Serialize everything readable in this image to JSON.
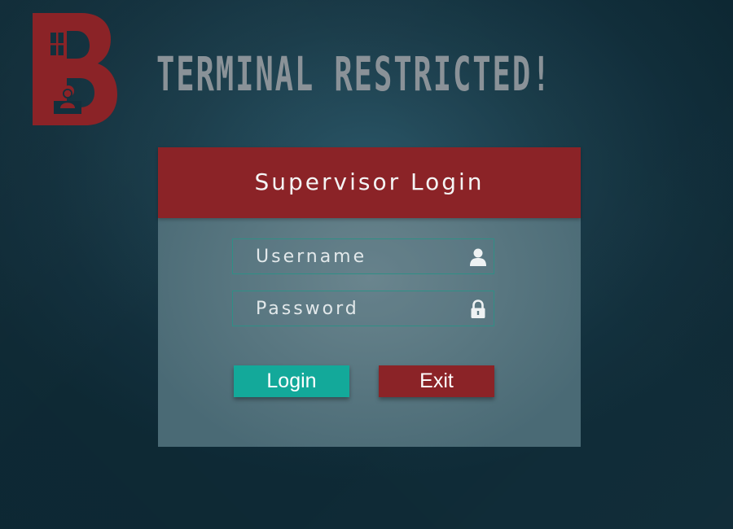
{
  "headline": "TERMINAL RESTRICTED!",
  "logo": {
    "letter": "B",
    "color": "#8b2327"
  },
  "login": {
    "title": "Supervisor Login",
    "username": {
      "placeholder": "Username",
      "value": "",
      "icon": "user-icon"
    },
    "password": {
      "placeholder": "Password",
      "value": "",
      "icon": "padlock-icon"
    },
    "buttons": {
      "login_label": "Login",
      "exit_label": "Exit"
    }
  },
  "colors": {
    "background": "#1b3d4b",
    "header_red": "#8b2327",
    "login_teal": "#13a99a",
    "exit_red": "#8b2327",
    "field_border": "#2f8f86",
    "headline_gray": "#8a9298"
  }
}
